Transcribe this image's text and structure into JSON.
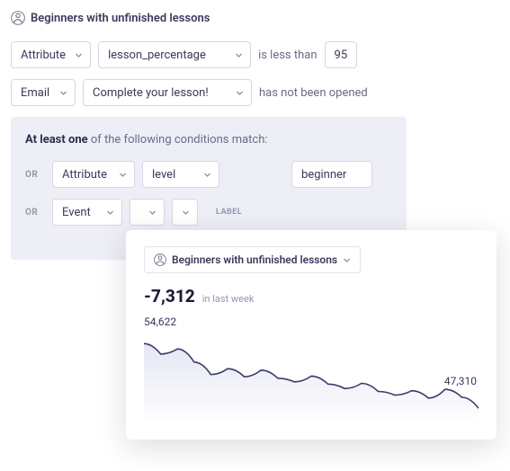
{
  "segment": {
    "title": "Beginners with unfinished lessons"
  },
  "filter1": {
    "type_label": "Attribute",
    "attribute_label": "lesson_percentage",
    "operator_text": "is less than",
    "value": "95"
  },
  "filter2": {
    "type_label": "Email",
    "email_label": "Complete your lesson!",
    "status_text": "has not been opened"
  },
  "conditions": {
    "heading_strong": "At least one",
    "heading_rest": " of the following conditions match:",
    "or_label": "OR",
    "row1": {
      "type": "Attribute",
      "attr": "level",
      "value": "beginner"
    },
    "row2": {
      "type": "Event",
      "label_tag": "LABEL"
    }
  },
  "chart_card": {
    "segment_label": "Beginners with unfinished lessons",
    "delta": "-7,312",
    "period": "in last week",
    "start_label": "54,622",
    "end_label": "47,310"
  },
  "chart_data": {
    "type": "line",
    "title": "Beginners with unfinished lessons",
    "xlabel": "",
    "ylabel": "",
    "ylim": [
      44000,
      56000
    ],
    "x": [
      0,
      1,
      2,
      3,
      4,
      5,
      6,
      7,
      8,
      9,
      10,
      11,
      12,
      13,
      14,
      15,
      16,
      17,
      18,
      19,
      20
    ],
    "values": [
      54622,
      53200,
      53900,
      52100,
      50400,
      51200,
      50100,
      51000,
      49900,
      49400,
      50200,
      49100,
      48500,
      49200,
      48100,
      47600,
      48200,
      47200,
      48400,
      47310,
      45800
    ]
  }
}
